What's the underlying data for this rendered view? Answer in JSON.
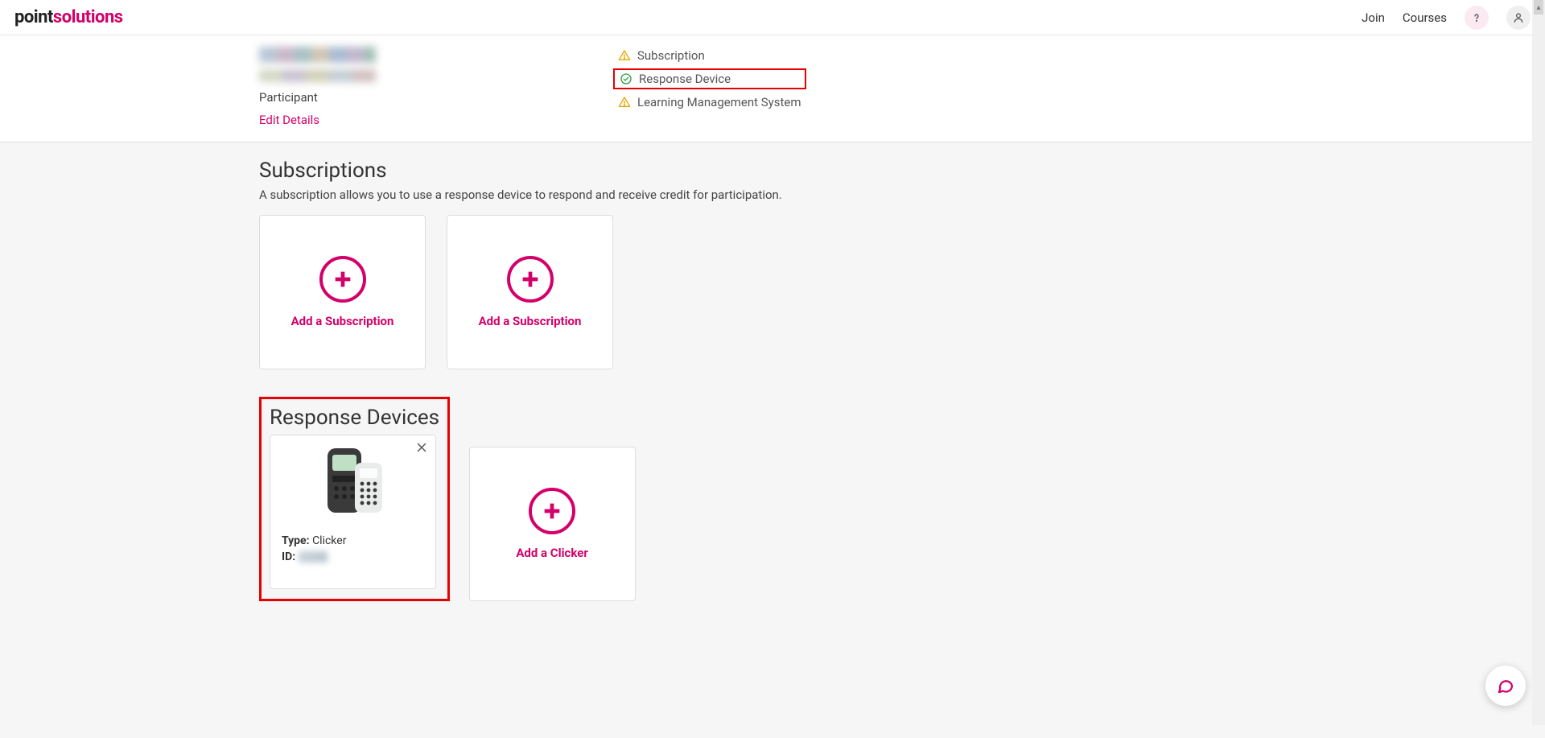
{
  "header": {
    "logo_primary": "point",
    "logo_accent": "solutions",
    "nav": {
      "join": "Join",
      "courses": "Courses"
    }
  },
  "profile": {
    "role": "Participant",
    "edit": "Edit Details",
    "status": {
      "subscription": "Subscription",
      "response_device": "Response Device",
      "lms": "Learning Management System"
    }
  },
  "subscriptions": {
    "title": "Subscriptions",
    "desc": "A subscription allows you to use a response device to respond and receive credit for participation.",
    "add_label": "Add a Subscription"
  },
  "devices": {
    "title": "Response Devices",
    "type_label": "Type:",
    "type_value": "Clicker",
    "id_label": "ID:",
    "add_label": "Add a Clicker"
  }
}
